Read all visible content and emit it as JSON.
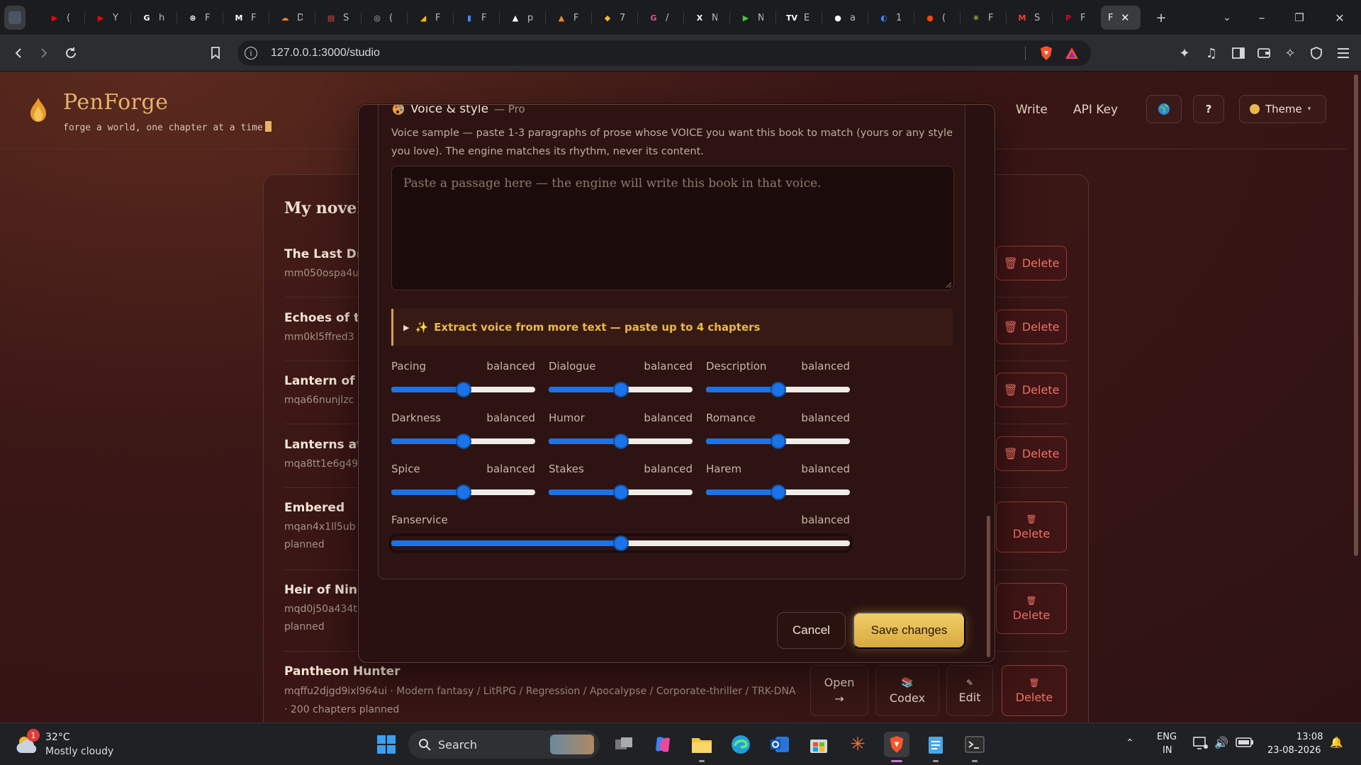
{
  "browser": {
    "tabs": [
      {
        "icon": "youtube-icon",
        "label": "(",
        "color": "#ff0000",
        "glyph": "▶"
      },
      {
        "icon": "youtube-icon",
        "label": "Y",
        "color": "#ff0000",
        "glyph": "▶"
      },
      {
        "icon": "google-icon",
        "label": "h",
        "color": "#ffffff",
        "glyph": "G"
      },
      {
        "icon": "openai-icon",
        "label": "F",
        "color": "#ffffff",
        "glyph": "⊛"
      },
      {
        "icon": "app-icon",
        "label": "F",
        "color": "#ffffff",
        "glyph": "M"
      },
      {
        "icon": "cloud-icon",
        "label": "D",
        "color": "#f48120",
        "glyph": "☁"
      },
      {
        "icon": "doc-icon",
        "label": "S",
        "color": "#e8453c",
        "glyph": "▤"
      },
      {
        "icon": "globe-icon",
        "label": "(",
        "color": "#bbbbbb",
        "glyph": "◎"
      },
      {
        "icon": "google-ads-icon",
        "label": "F",
        "color": "#fbbc04",
        "glyph": "◢"
      },
      {
        "icon": "analytics-icon",
        "label": "F",
        "color": "#4285f4",
        "glyph": "▮"
      },
      {
        "icon": "triangle-icon",
        "label": "p",
        "color": "#ffffff",
        "glyph": "▲"
      },
      {
        "icon": "flame-icon",
        "label": "F",
        "color": "#e8862a",
        "glyph": "▲"
      },
      {
        "icon": "binance-icon",
        "label": "7",
        "color": "#f3ba2f",
        "glyph": "◆"
      },
      {
        "icon": "grammarly-icon",
        "label": "/",
        "color": "#e54f9b",
        "glyph": "G"
      },
      {
        "icon": "x-icon",
        "label": "N",
        "color": "#ffffff",
        "glyph": "X"
      },
      {
        "icon": "play-icon",
        "label": "N",
        "color": "#46c93a",
        "glyph": "▶"
      },
      {
        "icon": "tv-icon",
        "label": "E",
        "color": "#ffffff",
        "glyph": "TV"
      },
      {
        "icon": "github-icon",
        "label": "a",
        "color": "#ffffff",
        "glyph": "●"
      },
      {
        "icon": "toggle-icon",
        "label": "1",
        "color": "#3b82f6",
        "glyph": "◐"
      },
      {
        "icon": "reddit-icon",
        "label": "(",
        "color": "#ff4500",
        "glyph": "●"
      },
      {
        "icon": "perplexity-icon",
        "label": "F",
        "color": "#c6e637",
        "glyph": "✳"
      },
      {
        "icon": "gmail-icon",
        "label": "S",
        "color": "#ea4335",
        "glyph": "M"
      },
      {
        "icon": "pinterest-icon",
        "label": "F",
        "color": "#e60023",
        "glyph": "P"
      }
    ],
    "active_tab_label": "F",
    "url": "127.0.0.1:3000/studio"
  },
  "app": {
    "brand_name": "PenForge",
    "tagline": "forge a world, one chapter at a time",
    "nav": {
      "write": "Write",
      "api_key": "API Key",
      "help": "?",
      "theme": "Theme"
    },
    "list_title": "My novel",
    "novels": [
      {
        "title": "The Last Dra",
        "id": "mm050ospa4u",
        "meta": "",
        "delete": "Delete"
      },
      {
        "title": "Echoes of th",
        "id": "mm0kl5ffred3",
        "meta": "",
        "delete": "Delete"
      },
      {
        "title": "Lantern of t",
        "id": "mqa66nunjlzc",
        "meta": "",
        "delete": "Delete"
      },
      {
        "title": "Lanterns at",
        "id": "mqa8tt1e6g49",
        "meta": "",
        "delete": "Delete"
      },
      {
        "title": "Embered",
        "id": "mqan4x1ll5ub",
        "meta": "planned",
        "delete": "Delete"
      },
      {
        "title": "Heir of Nine",
        "id": "mqd0j50a434t",
        "meta": "planned",
        "delete": "Delete"
      }
    ],
    "last_novel": {
      "title": "Pantheon Hunter",
      "meta": "mqffu2djgd9ixl964ui · Modern fantasy / LitRPG / Regression / Apocalypse / Corporate-thriller / TRK-DNA · 200 chapters planned",
      "open": "Open",
      "open_arrow": "→",
      "codex": "Codex",
      "edit": "Edit",
      "delete": "Delete"
    }
  },
  "modal": {
    "section_title": "Voice & style",
    "section_badge": "— Pro",
    "description": "Voice sample — paste 1-3 paragraphs of prose whose VOICE you want this book to match (yours or any style you love). The engine matches its rhythm, never its content.",
    "textarea_placeholder": "Paste a passage here — the engine will write this book in that voice.",
    "textarea_value": "",
    "extract_label": "Extract voice from more text — paste up to 4 chapters",
    "sliders": [
      {
        "label": "Pacing",
        "value": "balanced",
        "level": 0.5
      },
      {
        "label": "Dialogue",
        "value": "balanced",
        "level": 0.5
      },
      {
        "label": "Description",
        "value": "balanced",
        "level": 0.5
      },
      {
        "label": "Darkness",
        "value": "balanced",
        "level": 0.5
      },
      {
        "label": "Humor",
        "value": "balanced",
        "level": 0.5
      },
      {
        "label": "Romance",
        "value": "balanced",
        "level": 0.5
      },
      {
        "label": "Spice",
        "value": "balanced",
        "level": 0.5
      },
      {
        "label": "Stakes",
        "value": "balanced",
        "level": 0.5
      },
      {
        "label": "Harem",
        "value": "balanced",
        "level": 0.5
      },
      {
        "label": "Fanservice",
        "value": "balanced",
        "level": 0.5
      }
    ],
    "cancel": "Cancel",
    "save": "Save changes"
  },
  "taskbar": {
    "weather_temp": "32°C",
    "weather_desc": "Mostly cloudy",
    "weather_badge": "1",
    "search_label": "Search",
    "lang_top": "ENG",
    "lang_bottom": "IN",
    "time": "13:08",
    "date": "23-08-2026"
  },
  "colors": {
    "accent_gold": "#e6b36a",
    "slider_blue": "#1a73e8",
    "delete_red": "#f07466",
    "page_bg": "#3a1716"
  }
}
